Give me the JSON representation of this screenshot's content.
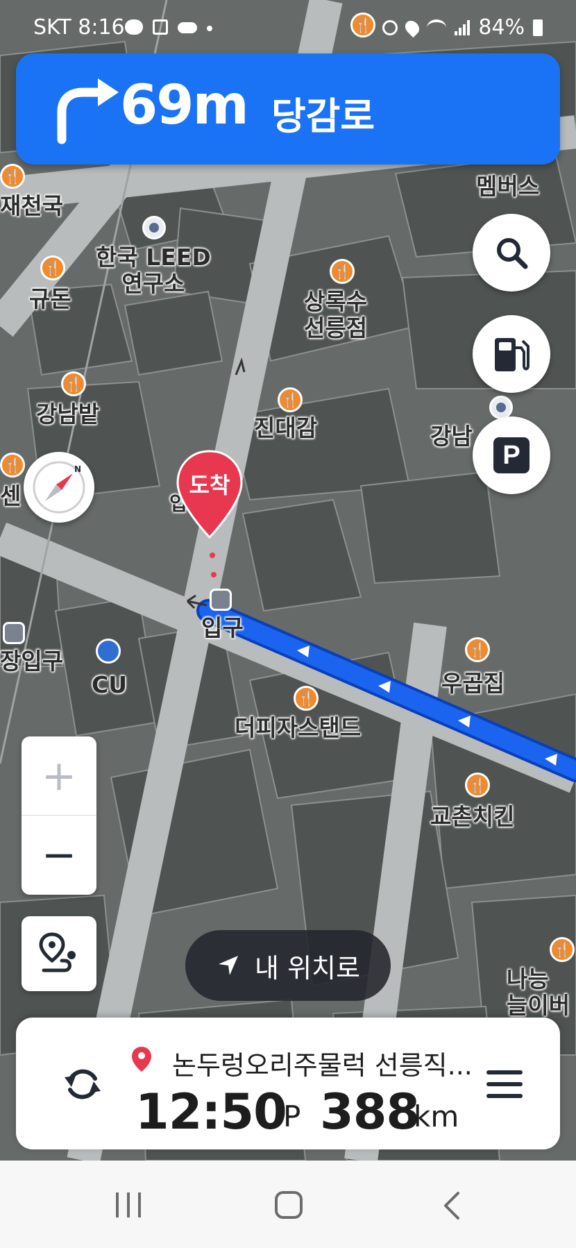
{
  "status_bar": {
    "carrier": "SKT",
    "time": "8:16",
    "battery": "84%"
  },
  "guidance": {
    "turn_direction": "right",
    "distance": "69m",
    "road_name": "당감로"
  },
  "map": {
    "labels": [
      "한국 LEED\n연구소",
      "규돈",
      "상록수\n선릉점",
      "강남밭",
      "진대감",
      "강남",
      "입구",
      "입구",
      "장입구",
      "CU",
      "우곱집",
      "더피자스탠드",
      "교촌치킨",
      "나능\n늘이버",
      "멤버스",
      "재천국",
      "센"
    ],
    "destination_marker": "도착",
    "route_color": "#1a64f0"
  },
  "buttons": {
    "search_icon": "search-icon",
    "gas_icon": "gas-station-icon",
    "parking_label": "P",
    "zoom_in": "+",
    "zoom_out": "−",
    "my_location_label": "내 위치로"
  },
  "bottom_card": {
    "destination": "논두렁오리주물럭 선릉직...",
    "eta": "12:50",
    "eta_suffix": "P",
    "remaining_distance": "388",
    "remaining_unit": "km"
  },
  "colors": {
    "accent": "#1a73f5",
    "destination_pin": "#e8384f",
    "poi_food": "#f08a2c"
  }
}
